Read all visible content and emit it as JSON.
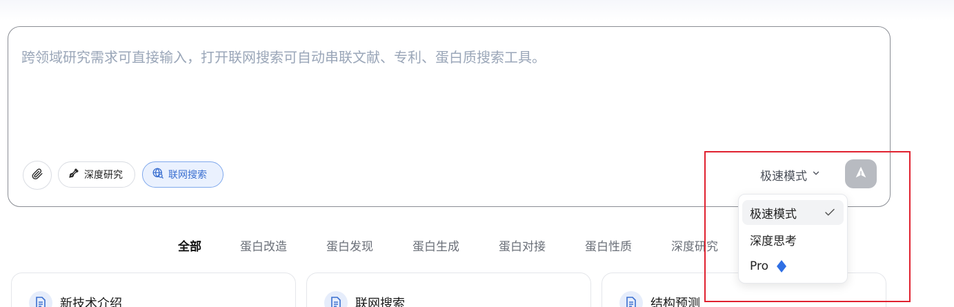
{
  "input": {
    "placeholder": "跨领域研究需求可直接输入，打开联网搜索可自动串联文献、专利、蛋白质搜索工具。",
    "value": ""
  },
  "toolbar": {
    "attach_icon": "paperclip-icon",
    "deep_research_label": "深度研究",
    "deep_research_icon": "research-pen-icon",
    "web_search_label": "联网搜索",
    "web_search_icon": "globe-search-icon",
    "web_search_active": true,
    "mode_label": "极速模式",
    "mode_chevron_icon": "chevron-down-icon",
    "send_icon": "send-arrow-icon"
  },
  "mode_menu": {
    "items": [
      {
        "label": "极速模式",
        "selected": true,
        "icon": "check-icon"
      },
      {
        "label": "深度思考",
        "selected": false
      },
      {
        "label": "Pro",
        "selected": false,
        "icon": "diamond-icon"
      }
    ]
  },
  "tabs": [
    {
      "label": "全部",
      "active": true
    },
    {
      "label": "蛋白改造",
      "active": false
    },
    {
      "label": "蛋白发现",
      "active": false
    },
    {
      "label": "蛋白生成",
      "active": false
    },
    {
      "label": "蛋白对接",
      "active": false
    },
    {
      "label": "蛋白性质",
      "active": false
    },
    {
      "label": "深度研究",
      "active": false
    }
  ],
  "cards": [
    {
      "title": "新技术介绍",
      "icon": "document-icon"
    },
    {
      "title": "联网搜索",
      "icon": "document-icon"
    },
    {
      "title": "结构预测",
      "icon": "document-icon"
    }
  ],
  "colors": {
    "accent": "#3a6fd0",
    "highlight": "#e0212f",
    "send_disabled": "#b8bbc1"
  }
}
